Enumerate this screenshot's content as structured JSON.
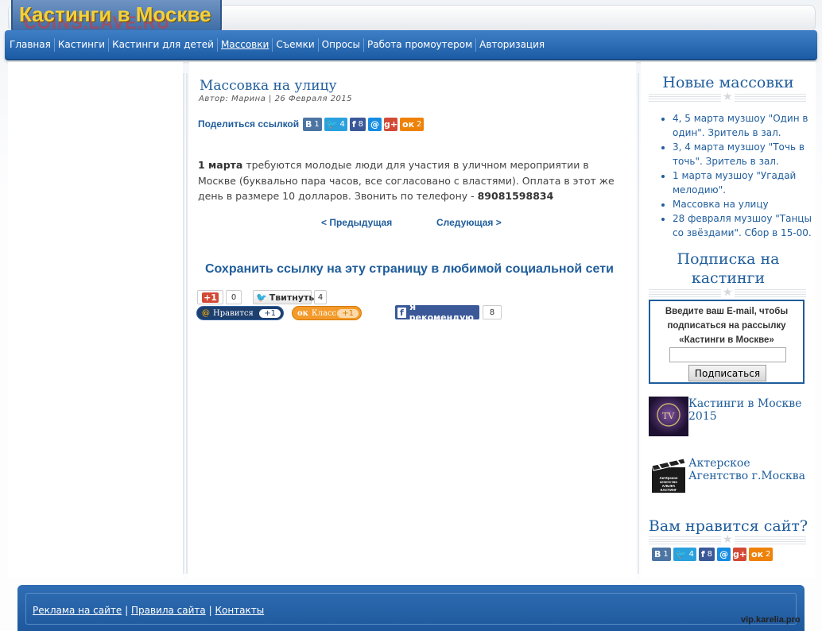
{
  "header": {
    "logo_title": "Кастинги в Москве",
    "logo_watermark": "COINS.LAVE.RU"
  },
  "nav": {
    "items": [
      "Главная",
      "Кастинги",
      "Кастинги для детей",
      "Массовки",
      "Съемки",
      "Опросы",
      "Работа промоутером",
      "Авторизация"
    ],
    "active": "Массовки"
  },
  "article": {
    "title": "Массовка на улицу",
    "meta": "Автор: Марина | 26 Февраля 2015",
    "share_label": "Поделиться ссылкой",
    "body_bold_date": "1 марта",
    "body_text": " требуются молодые люди для участия в уличном мероприятии в Москве (буквально пара часов, все согласовано с властями). Оплата в этот же день в размере 10 долларов. Звонить по телефону - ",
    "phone": "89081598834",
    "prev_label": "< Предыдущая",
    "next_label": "Следующая >",
    "save_title": "Сохранить ссылку на эту страницу в любимой социальной сети"
  },
  "share_counts": {
    "vk": "1",
    "twitter": "4",
    "facebook": "8",
    "mailru": "",
    "googleplus": "",
    "ok": "2"
  },
  "share_icons": {
    "vk": "В",
    "twitter": "🐦",
    "facebook": "f",
    "mailru": "@",
    "googleplus": "g+",
    "ok": "ок"
  },
  "social_buttons": {
    "gplus_label": "+1",
    "gplus_count": "0",
    "tweet_label": "Твитнуть",
    "tweet_count": "4",
    "mail_like_label": "Нравится",
    "mail_like_count": "+1",
    "ok_class_label": "Класс",
    "ok_class_count": "+1",
    "fb_recommend_label": "Я рекомендую",
    "fb_recommend_count": "8"
  },
  "sidebar": {
    "news_title": "Новые массовки",
    "news_items": [
      "4, 5 марта музшоу \"Один в один\". Зритель в зал.",
      "3, 4 марта музшоу \"Точь в точь\". Зритель в зал.",
      "1 марта музшоу \"Угадай мелодию\".",
      "Массовка на улицу",
      "28 февраля музшоу \"Танцы со звёздами\". Сбор в 15-00."
    ],
    "subscribe_title": "Подписка на кастинги",
    "subscribe_text": "Введите ваш E-mail, чтобы подписаться на рассылку «Кастинги в Москве»",
    "subscribe_button": "Подписаться",
    "promo1_text": "Кастинги в Москве 2015",
    "promo2_text": "Актерское Агентство г.Москва",
    "promo2_img_text": "Актёрское агентство АЛЬФА КАСТИНГ",
    "like_title": "Вам нравится сайт?"
  },
  "footer": {
    "ads": "Реклама на сайте",
    "rules": "Правила сайта",
    "contacts": "Контакты",
    "sep": "|"
  },
  "watermark": "vip.karelia.pro",
  "colors": {
    "link": "#1f5d9c",
    "nav": "#2b6cb4",
    "vk": "#4c75a3",
    "twitter": "#2aa1dd",
    "facebook": "#3b5998",
    "ok": "#ee8208",
    "gplus": "#d24a35",
    "mailru": "#168de2"
  }
}
